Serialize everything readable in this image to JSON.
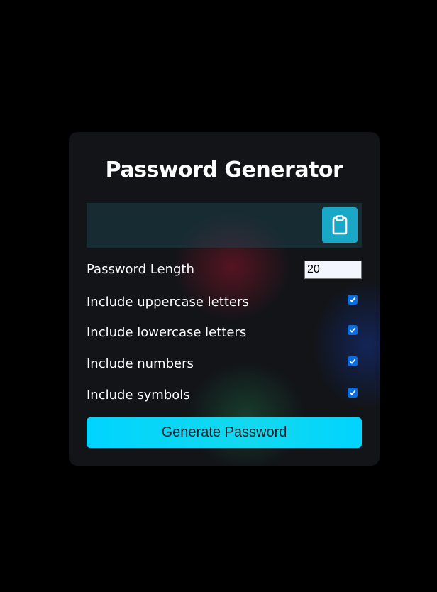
{
  "app": {
    "title": "Password Generator"
  },
  "result": {
    "value": "",
    "copy_icon": "clipboard-icon"
  },
  "settings": {
    "length": {
      "label": "Password Length",
      "value": "20"
    },
    "options": [
      {
        "label": "Include uppercase letters",
        "checked": true
      },
      {
        "label": "Include lowercase letters",
        "checked": true
      },
      {
        "label": "Include numbers",
        "checked": true
      },
      {
        "label": "Include symbols",
        "checked": true
      }
    ]
  },
  "actions": {
    "generate_label": "Generate Password"
  },
  "colors": {
    "page_background": "#000000",
    "card_background": "#121418",
    "accent": "#00d4ff",
    "copy_button": "#1aa8c8",
    "checkbox": "#0b6ddf"
  }
}
